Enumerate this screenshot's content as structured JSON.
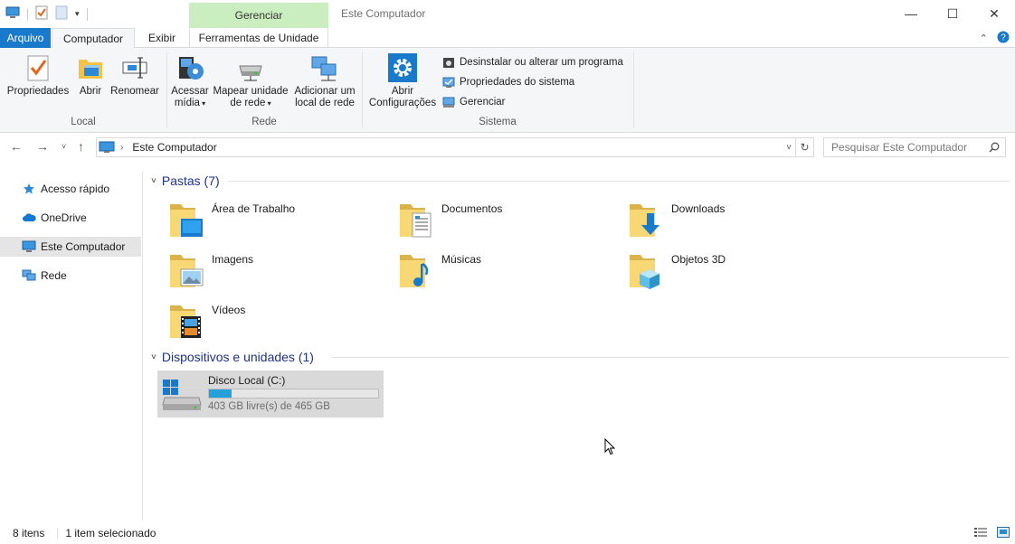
{
  "window": {
    "title": "Este Computador",
    "context_tab_header": "Gerenciar",
    "controls": {
      "minimize": "—",
      "maximize": "☐",
      "close": "✕"
    }
  },
  "tabs": [
    {
      "label": "Arquivo"
    },
    {
      "label": "Computador"
    },
    {
      "label": "Exibir"
    },
    {
      "label": "Ferramentas de Unidade"
    }
  ],
  "ribbon": {
    "groups": {
      "local": "Local",
      "rede": "Rede",
      "sistema": "Sistema"
    },
    "buttons": {
      "propriedades": "Propriedades",
      "abrir": "Abrir",
      "renomear": "Renomear",
      "acessar_midia_1": "Acessar",
      "acessar_midia_2": "mídia",
      "mapear_1": "Mapear unidade",
      "mapear_2": "de rede",
      "adicionar_1": "Adicionar um",
      "adicionar_2": "local de rede",
      "abrir_config_1": "Abrir",
      "abrir_config_2": "Configurações"
    },
    "small_buttons": {
      "desinstalar": "Desinstalar ou alterar um programa",
      "propriedades_sistema": "Propriedades do sistema",
      "gerenciar": "Gerenciar"
    }
  },
  "address": {
    "crumb": "Este Computador",
    "search_placeholder": "Pesquisar Este Computador"
  },
  "sidebar": {
    "items": [
      {
        "label": "Acesso rápido"
      },
      {
        "label": "OneDrive"
      },
      {
        "label": "Este Computador"
      },
      {
        "label": "Rede"
      }
    ]
  },
  "content": {
    "folders_header": "Pastas (7)",
    "folders": [
      {
        "name": "Área de Trabalho"
      },
      {
        "name": "Documentos"
      },
      {
        "name": "Downloads"
      },
      {
        "name": "Imagens"
      },
      {
        "name": "Músicas"
      },
      {
        "name": "Objetos 3D"
      },
      {
        "name": "Vídeos"
      }
    ],
    "devices_header": "Dispositivos e unidades (1)",
    "drive": {
      "name": "Disco Local (C:)",
      "free_text": "403 GB livre(s) de 465 GB",
      "used_fraction": 0.133
    }
  },
  "status": {
    "count": "8 itens",
    "selection": "1 item selecionado"
  },
  "colors": {
    "accent": "#1979ca",
    "context_tab": "#cbeec0",
    "drive_fill": "#26a0da",
    "section_header": "#1e3287"
  }
}
